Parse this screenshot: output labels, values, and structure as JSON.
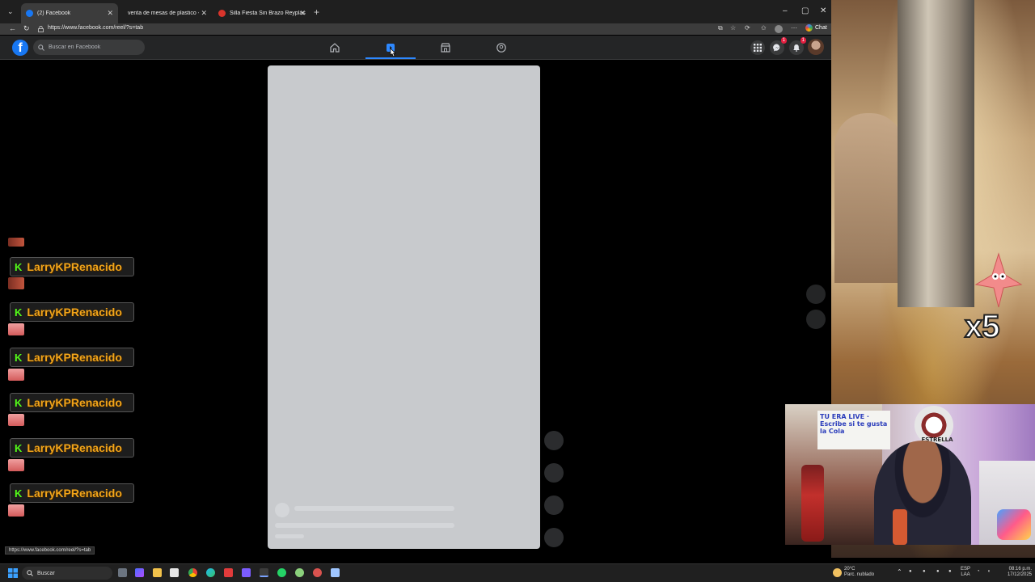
{
  "browser": {
    "tabs": [
      {
        "title": "(2) Facebook",
        "active": true,
        "favicon_color": "#1877f2"
      },
      {
        "title": "venta de mesas de plastico - Bús",
        "active": false,
        "favicon_color": ""
      },
      {
        "title": "Silla Fiesta Sin Brazo Reyplast",
        "active": false,
        "favicon_color": "#d9342b"
      }
    ],
    "url": "https://www.facebook.com/reel/?s=tab",
    "chat_label": "Chat",
    "status_url": "https://www.facebook.com/reel/?s=tab"
  },
  "facebook": {
    "search_placeholder": "Buscar en Facebook",
    "nav": [
      "home-icon",
      "reels-icon",
      "marketplace-icon",
      "groups-icon"
    ],
    "active_nav": "reels-icon",
    "accent": "#1877f2",
    "messenger_badge": "1",
    "notifications_badge": "1"
  },
  "chat_overlay": {
    "messages": [
      {
        "username": "LarryKPRenacido"
      },
      {
        "username": "LarryKPRenacido"
      },
      {
        "username": "LarryKPRenacido"
      },
      {
        "username": "LarryKPRenacido"
      },
      {
        "username": "LarryKPRenacido"
      },
      {
        "username": "LarryKPRenacido"
      }
    ],
    "platform_icon": "K",
    "username_color": "#f2a51a",
    "platform_color": "#53fc18"
  },
  "stream_overlay": {
    "multiplier": "x5"
  },
  "webcam": {
    "sign_text": "TU ERA LIVE · Escribe si te gusta la Cola",
    "logo_text": "ESTRELLA"
  },
  "taskbar": {
    "search_label": "Buscar",
    "weather_temp": "20°C",
    "weather_desc": "Parc. nublado",
    "lang_top": "ESP",
    "lang_bottom": "LAA",
    "time": "08:16 p.m.",
    "date": "17/12/2025"
  }
}
